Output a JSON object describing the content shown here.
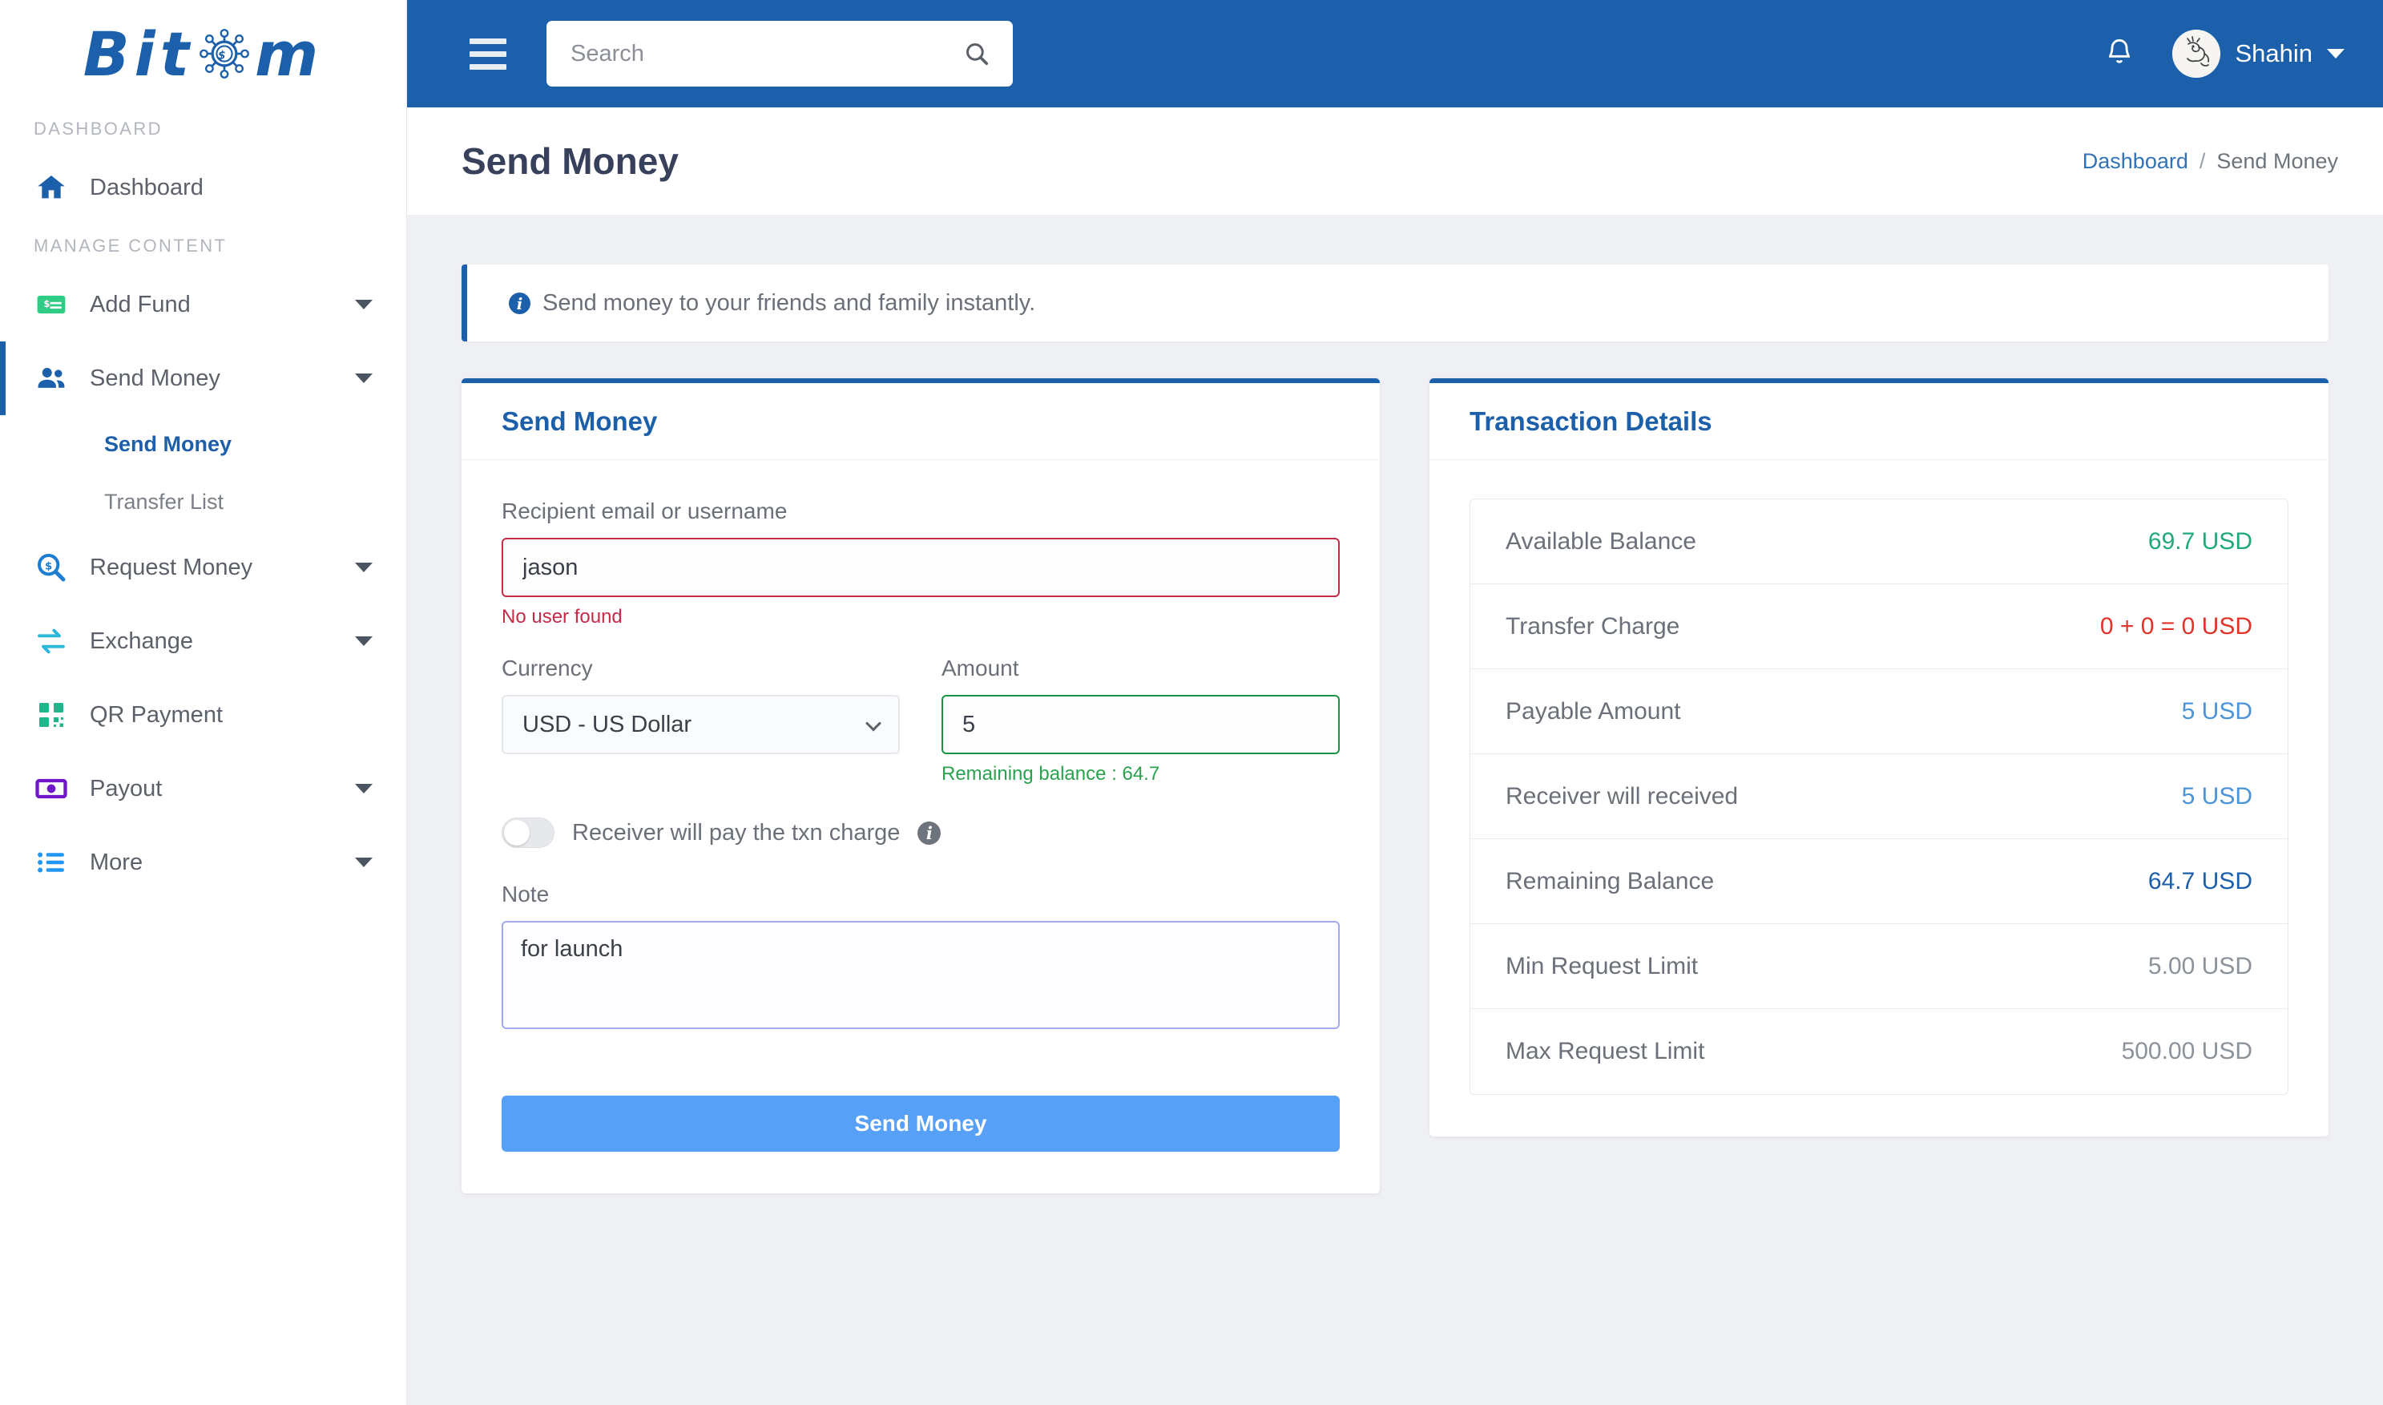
{
  "brand": {
    "name_part1": "Bit",
    "name_part2": "m",
    "coin_icon": "dollar-coin-icon",
    "accent": "#1c5faa"
  },
  "sidebar": {
    "sections": [
      {
        "title": "DASHBOARD"
      },
      {
        "title": "MANAGE CONTENT"
      }
    ],
    "dashboard_item": {
      "label": "Dashboard",
      "icon": "home-icon",
      "color": "#1c5faa"
    },
    "items": [
      {
        "label": "Add Fund",
        "icon": "money-check-icon",
        "color": "#2ecc85",
        "has_caret": true,
        "active": false
      },
      {
        "label": "Send Money",
        "icon": "users-icon",
        "color": "#1c5faa",
        "has_caret": true,
        "active": true
      },
      {
        "label": "Request Money",
        "icon": "search-dollar-icon",
        "color": "#1c7dd1",
        "has_caret": true,
        "active": false
      },
      {
        "label": "Exchange",
        "icon": "exchange-arrows-icon",
        "color": "#29b6d8",
        "has_caret": true,
        "active": false
      },
      {
        "label": "QR Payment",
        "icon": "qr-code-icon",
        "color": "#21b58c",
        "has_caret": false,
        "active": false
      },
      {
        "label": "Payout",
        "icon": "banknote-icon",
        "color": "#6f17c9",
        "has_caret": true,
        "active": false
      },
      {
        "label": "More",
        "icon": "list-icon",
        "color": "#2196f3",
        "has_caret": true,
        "active": false
      }
    ],
    "submenu": [
      {
        "label": "Send Money",
        "active": true
      },
      {
        "label": "Transfer List",
        "active": false
      }
    ]
  },
  "topbar": {
    "menu_icon": "hamburger-icon",
    "search": {
      "value": "",
      "placeholder": "Search",
      "icon": "search-icon"
    },
    "notification_icon": "bell-icon",
    "user": {
      "name": "Shahin",
      "avatar": "dragon-avatar"
    }
  },
  "page": {
    "title": "Send Money",
    "breadcrumb": {
      "root": "Dashboard",
      "separator": "/",
      "current": "Send Money"
    }
  },
  "alert": {
    "icon": "info-icon",
    "text": "Send money to your friends and family instantly."
  },
  "form_card": {
    "title": "Send Money",
    "recipient": {
      "label": "Recipient email or username",
      "value": "jason",
      "placeholder": "",
      "error": "No user found",
      "state": "invalid"
    },
    "currency": {
      "label": "Currency",
      "selected": "USD - US Dollar",
      "options": [
        "USD - US Dollar"
      ]
    },
    "amount": {
      "label": "Amount",
      "value": "5",
      "help": "Remaining balance : 64.7",
      "state": "valid"
    },
    "charge_toggle": {
      "label": "Receiver will pay the txn charge",
      "checked": false,
      "info_icon": "info-circle-icon"
    },
    "note": {
      "label": "Note",
      "value": "for launch",
      "placeholder": ""
    },
    "submit_label": "Send Money"
  },
  "details_card": {
    "title": "Transaction Details",
    "rows": [
      {
        "key": "Available Balance",
        "value": "69.7 USD",
        "style": "v-teal"
      },
      {
        "key": "Transfer Charge",
        "value": "0 + 0 = 0 USD",
        "style": "v-red"
      },
      {
        "key": "Payable Amount",
        "value": "5 USD",
        "style": "v-blue"
      },
      {
        "key": "Receiver will received",
        "value": "5 USD",
        "style": "v-blue"
      },
      {
        "key": "Remaining Balance",
        "value": "64.7 USD",
        "style": "v-navy"
      },
      {
        "key": "Min Request Limit",
        "value": "5.00 USD",
        "style": "v-grey"
      },
      {
        "key": "Max Request Limit",
        "value": "500.00 USD",
        "style": "v-grey"
      }
    ]
  }
}
